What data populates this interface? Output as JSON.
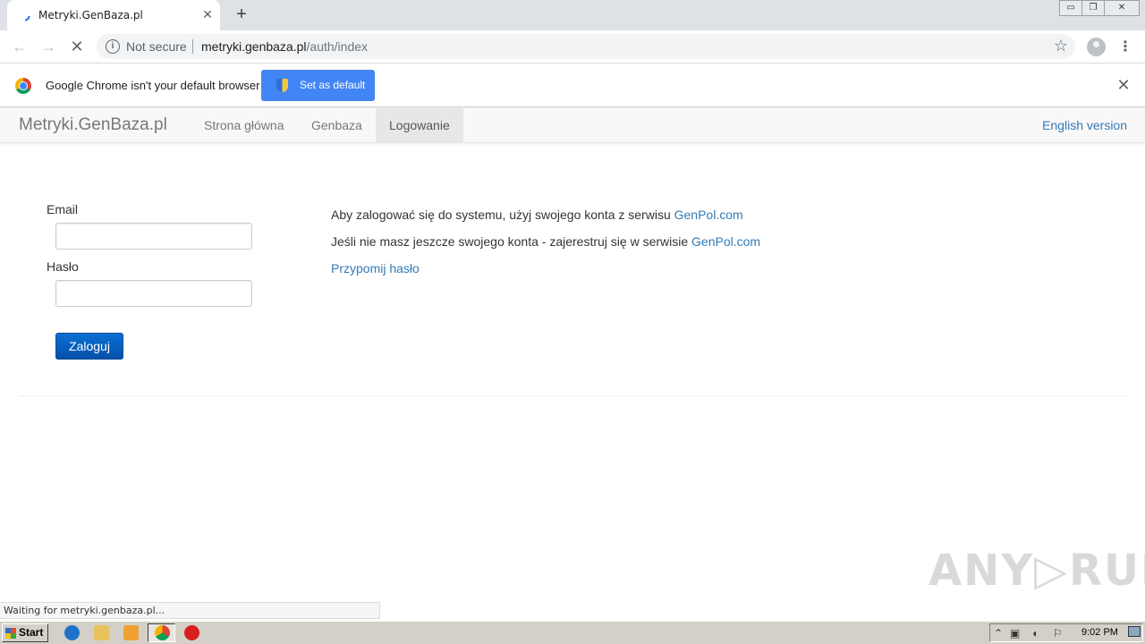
{
  "browser": {
    "tab_title": "Metryki.GenBaza.pl",
    "tab_close": "✕",
    "new_tab": "+",
    "back_icon": "←",
    "forward_icon": "→",
    "reload_icon": "✕",
    "security_label": "Not secure",
    "url_host": "metryki.genbaza.pl",
    "url_path": "/auth/index",
    "bookmark_icon": "☆",
    "menu_icon": "⋮",
    "window_min": "▭",
    "window_restore": "❐",
    "window_close": "✕"
  },
  "infobar": {
    "message": "Google Chrome isn't your default browser",
    "button_label": "Set as default",
    "close": "✕"
  },
  "site_nav": {
    "brand": "Metryki.GenBaza.pl",
    "links": [
      "Strona główna",
      "Genbaza",
      "Logowanie"
    ],
    "active_index": 2,
    "english": "English version"
  },
  "login_form": {
    "email_label": "Email",
    "email_value": "",
    "password_label": "Hasło",
    "password_value": "",
    "submit_label": "Zaloguj"
  },
  "info": {
    "line1_text": "Aby zalogować się do systemu, użyj swojego konta z serwisu ",
    "line1_link": "GenPol.com",
    "line2_text": "Jeśli nie masz jeszcze swojego konta - zajerestruj się w serwisie ",
    "line2_link": "GenPol.com",
    "remind_link": "Przypomij hasło"
  },
  "status_text": "Waiting for metryki.genbaza.pl...",
  "watermark": "ANY▷RUN",
  "taskbar": {
    "start_label": "Start",
    "clock": "9:02 PM"
  },
  "colors": {
    "link": "#337ab7",
    "primary_button": "#0b6fd6",
    "chrome_blue": "#4285f4"
  }
}
